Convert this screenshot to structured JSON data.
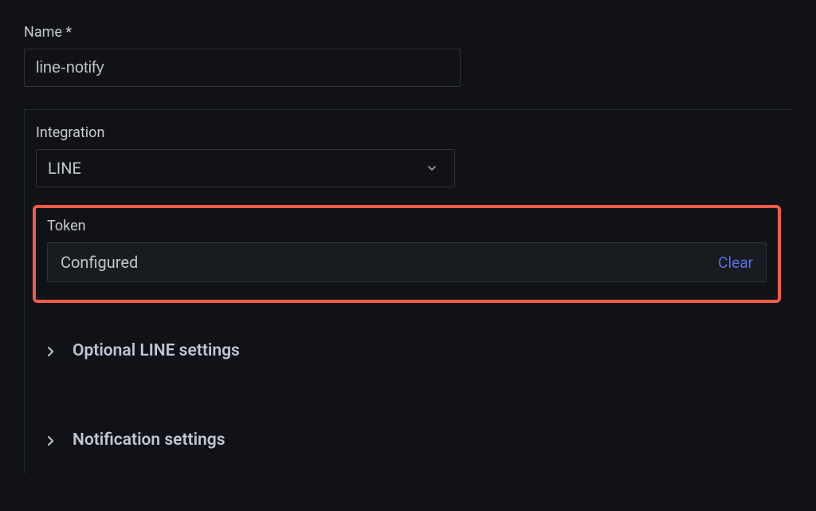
{
  "name_field": {
    "label": "Name *",
    "value": "line-notify"
  },
  "integration": {
    "label": "Integration",
    "selected": "LINE"
  },
  "token": {
    "label": "Token",
    "status": "Configured",
    "clear_label": "Clear"
  },
  "expanders": {
    "optional_line": "Optional LINE settings",
    "notification": "Notification settings"
  }
}
